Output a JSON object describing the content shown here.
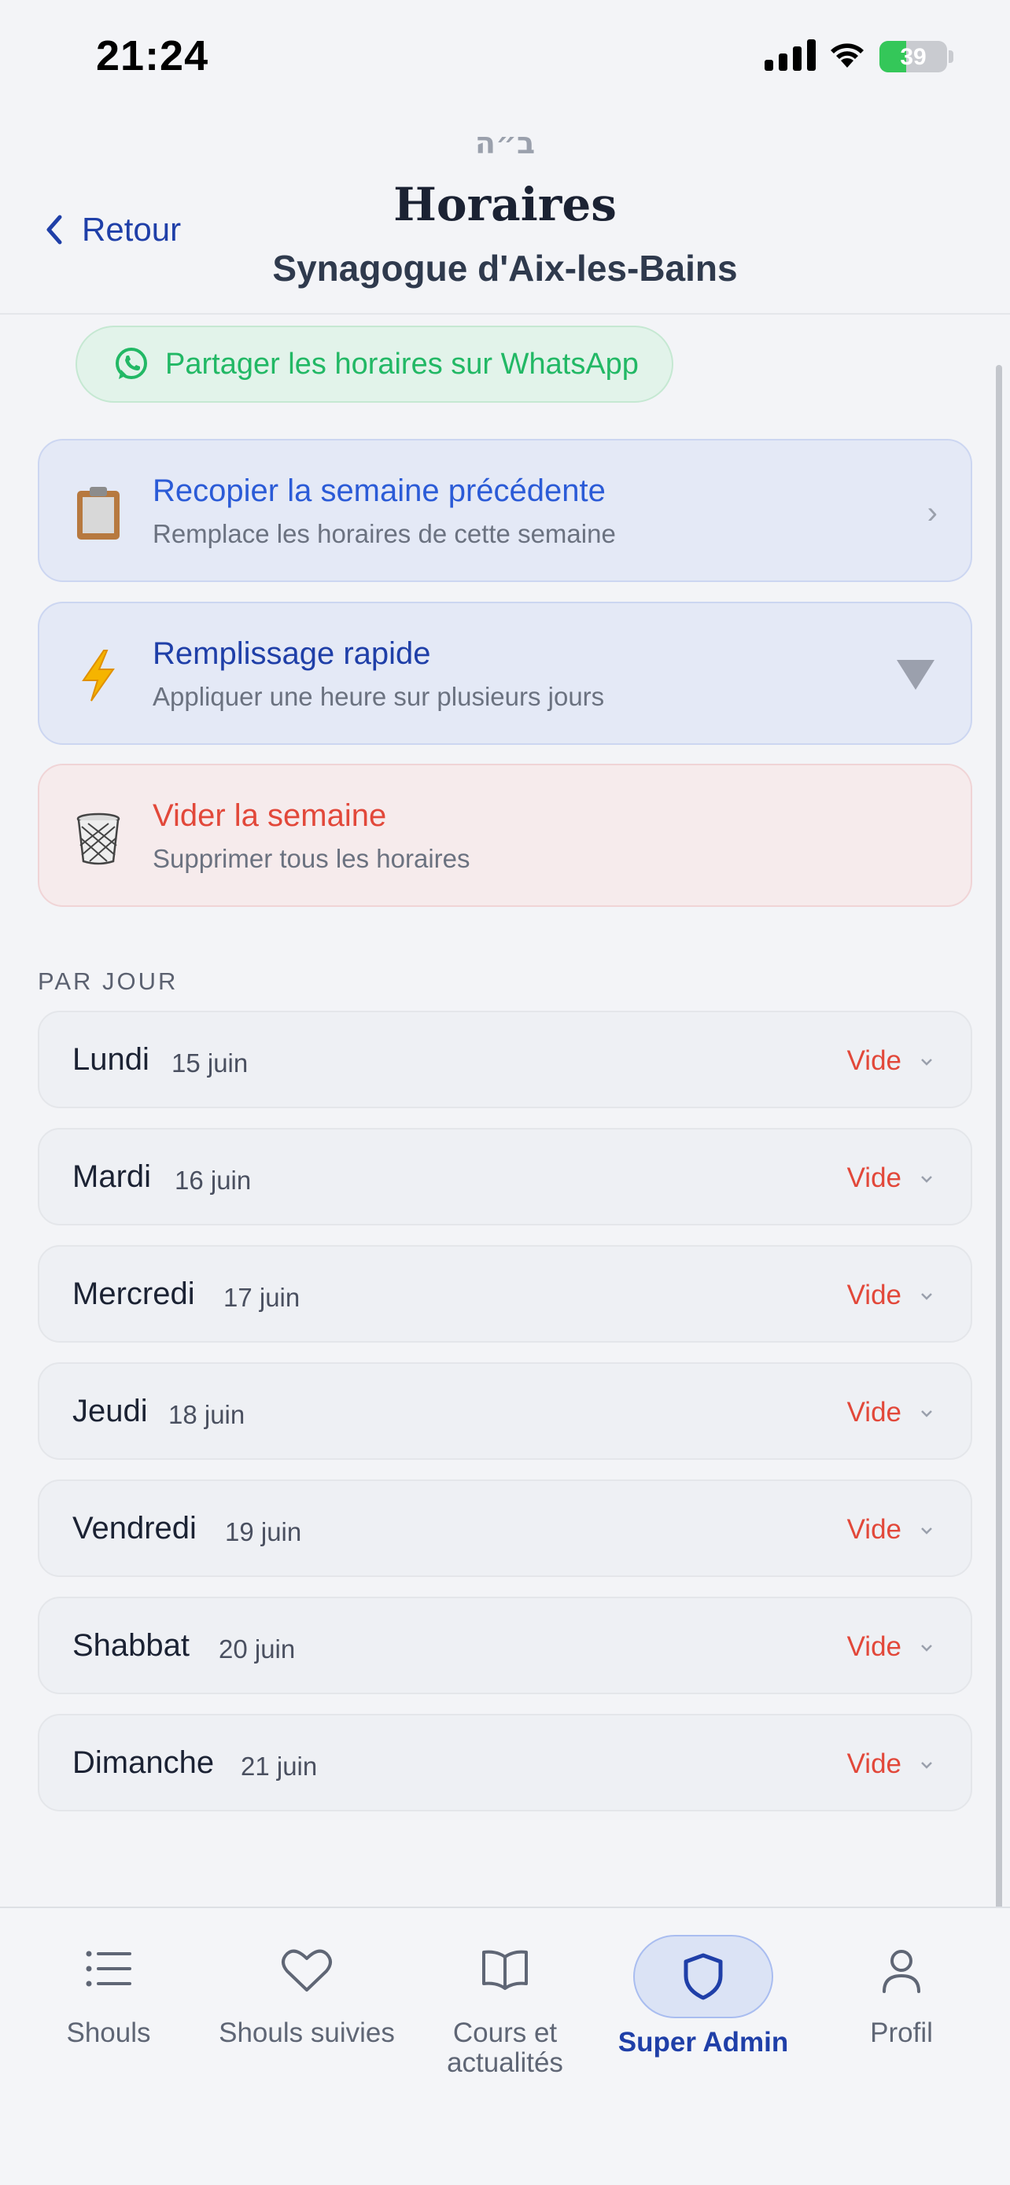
{
  "status_bar": {
    "time": "21:24",
    "battery": "39",
    "battery_level_pct": 39
  },
  "header": {
    "hebrew": "ב״ה",
    "title": "Horaires",
    "subtitle": "Synagogue d'Aix-les-Bains",
    "back_label": "Retour"
  },
  "share": {
    "label": "Partager les horaires sur WhatsApp",
    "icon": "whatsapp-icon",
    "color": "#22b865"
  },
  "actions": [
    {
      "title": "Recopier la semaine précédente",
      "subtitle": "Remplace les horaires de cette semaine",
      "icon": "clipboard-icon"
    },
    {
      "title": "Remplissage rapide",
      "subtitle": "Appliquer une heure sur plusieurs jours",
      "icon": "lightning-icon"
    },
    {
      "title": "Vider la semaine",
      "subtitle": "Supprimer tous les horaires",
      "icon": "trash-icon"
    }
  ],
  "section_label": "PAR JOUR",
  "days": [
    {
      "name": "Lundi",
      "date": "15 juin",
      "status": "Vide"
    },
    {
      "name": "Mardi",
      "date": "16 juin",
      "status": "Vide"
    },
    {
      "name": "Mercredi",
      "date": "17 juin",
      "status": "Vide"
    },
    {
      "name": "Jeudi",
      "date": "18 juin",
      "status": "Vide"
    },
    {
      "name": "Vendredi",
      "date": "19 juin",
      "status": "Vide"
    },
    {
      "name": "Shabbat",
      "date": "20 juin",
      "status": "Vide"
    },
    {
      "name": "Dimanche",
      "date": "21 juin",
      "status": "Vide"
    }
  ],
  "tabs": [
    {
      "label": "Shouls",
      "icon": "list-icon"
    },
    {
      "label": "Shouls suivies",
      "icon": "heart-icon"
    },
    {
      "label_line1": "Cours et",
      "label_line2": "actualités",
      "icon": "book-icon"
    },
    {
      "label": "Super Admin",
      "icon": "shield-icon",
      "active": true
    },
    {
      "label": "Profil",
      "icon": "user-icon"
    }
  ],
  "colors": {
    "accent": "#1f3fa8",
    "danger": "#e2483a",
    "whatsapp": "#22b865"
  }
}
